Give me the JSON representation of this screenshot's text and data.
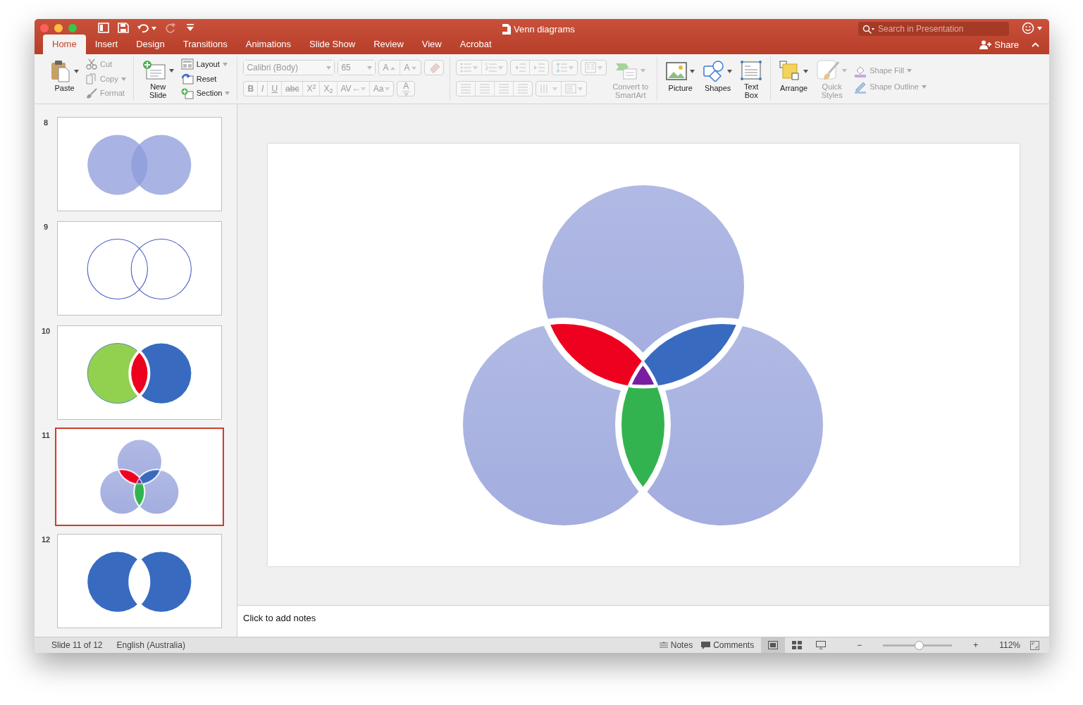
{
  "window": {
    "title": "Venn diagrams",
    "search": {
      "placeholder": "Search in Presentation"
    }
  },
  "quick_access": [
    {
      "disabled": false,
      "dropdown": false
    },
    {
      "disabled": false,
      "dropdown": false
    },
    {
      "disabled": false,
      "dropdown": true
    },
    {
      "disabled": true,
      "dropdown": false
    },
    {
      "disabled": false,
      "dropdown": false
    }
  ],
  "tabs": [
    {
      "label": "Home",
      "selected": true
    },
    {
      "label": "Insert",
      "selected": false
    },
    {
      "label": "Design",
      "selected": false
    },
    {
      "label": "Transitions",
      "selected": false
    },
    {
      "label": "Animations",
      "selected": false
    },
    {
      "label": "Slide Show",
      "selected": false
    },
    {
      "label": "Review",
      "selected": false
    },
    {
      "label": "View",
      "selected": false
    },
    {
      "label": "Acrobat",
      "selected": false
    }
  ],
  "share": "Share",
  "ribbon": [
    {
      "items": [
        {
          "kind": "large",
          "label": "Paste",
          "disabled": false,
          "dropdown": true
        },
        {
          "kind": "small",
          "label": "Cut",
          "disabled": true,
          "dropdown": false
        },
        {
          "kind": "small",
          "label": "Copy",
          "disabled": true,
          "dropdown": true
        },
        {
          "kind": "small",
          "label": "Format",
          "disabled": true,
          "dropdown": false
        }
      ]
    },
    {
      "items": [
        {
          "kind": "large",
          "label": "New\nSlide",
          "disabled": false,
          "dropdown": true
        },
        {
          "kind": "small",
          "label": "Layout",
          "disabled": false,
          "dropdown": true
        },
        {
          "kind": "small",
          "label": "Reset",
          "disabled": false,
          "dropdown": false
        },
        {
          "kind": "small",
          "label": "Section",
          "disabled": false,
          "dropdown": true
        }
      ]
    },
    {
      "rows": [
        {
          "segments": [
            {
              "tools": [
                {
                  "kind": "field",
                  "value": "Calibri (Body)",
                  "disabled": true
                }
              ]
            },
            {
              "tools": [
                {
                  "kind": "field",
                  "value": "65",
                  "disabled": true
                }
              ]
            },
            {
              "tools": [
                {
                  "kind": "tool",
                  "label": "A",
                  "disabled": true,
                  "dropdown": false
                },
                {
                  "kind": "tool",
                  "label": "A",
                  "disabled": true,
                  "dropdown": false
                }
              ]
            },
            {
              "tools": [
                {
                  "kind": "tool",
                  "disabled": true,
                  "dropdown": false
                }
              ]
            }
          ]
        },
        {
          "segments": [
            {
              "tools": [
                {
                  "kind": "tool",
                  "label": "B",
                  "disabled": true,
                  "dropdown": false
                },
                {
                  "kind": "tool",
                  "label": "I",
                  "disabled": true,
                  "dropdown": false
                },
                {
                  "kind": "tool",
                  "label": "U",
                  "disabled": true,
                  "dropdown": false
                },
                {
                  "kind": "tool",
                  "label": "abc",
                  "disabled": true,
                  "dropdown": false
                },
                {
                  "kind": "tool",
                  "label": "X$^{2}$",
                  "disabled": true,
                  "dropdown": false
                },
                {
                  "kind": "tool",
                  "label": "X$_{2}$",
                  "disabled": true,
                  "dropdown": false
                },
                {
                  "kind": "tool",
                  "label": "AV",
                  "disabled": true,
                  "dropdown": true
                },
                {
                  "kind": "tool",
                  "label": "Aa",
                  "disabled": true,
                  "dropdown": true
                }
              ]
            },
            {
              "tools": [
                {
                  "kind": "tool",
                  "label": "A",
                  "disabled": true,
                  "dropdown": true
                }
              ]
            }
          ]
        }
      ]
    },
    {
      "rows": [
        {
          "segments": [
            {
              "tools": [
                {
                  "kind": "tool",
                  "disabled": true,
                  "dropdown": true
                },
                {
                  "kind": "tool",
                  "disabled": true,
                  "dropdown": true
                }
              ]
            },
            {
              "tools": [
                {
                  "kind": "tool",
                  "disabled": true,
                  "dropdown": false
                },
                {
                  "kind": "tool",
                  "disabled": true,
                  "dropdown": false
                }
              ]
            },
            {
              "tools": [
                {
                  "kind": "tool",
                  "disabled": true,
                  "dropdown": true
                }
              ]
            },
            {
              "tools": [
                {
                  "kind": "tool",
                  "disabled": true,
                  "dropdown": true
                }
              ]
            }
          ]
        },
        {
          "segments": [
            {
              "tools": [
                {
                  "kind": "tool",
                  "disabled": true,
                  "dropdown": false
                },
                {
                  "kind": "tool",
                  "disabled": true,
                  "dropdown": false
                },
                {
                  "kind": "tool",
                  "disabled": true,
                  "dropdown": false
                },
                {
                  "kind": "tool",
                  "disabled": true,
                  "dropdown": false
                }
              ]
            },
            {
              "tools": [
                {
                  "kind": "tool",
                  "disabled": true,
                  "dropdown": true
                },
                {
                  "kind": "tool",
                  "disabled": true,
                  "dropdown": true
                }
              ]
            }
          ]
        }
      ],
      "items": [
        {
          "kind": "large",
          "label": "Convert to\nSmartArt",
          "disabled": true,
          "dropdown": true
        }
      ]
    },
    {
      "items": [
        {
          "kind": "large",
          "label": "Picture",
          "disabled": false,
          "dropdown": true
        },
        {
          "kind": "large",
          "label": "Shapes",
          "disabled": false,
          "dropdown": true
        },
        {
          "kind": "large",
          "label": "Text\nBox",
          "disabled": false,
          "dropdown": false
        }
      ]
    },
    {
      "items": [
        {
          "kind": "large",
          "label": "Arrange",
          "disabled": false,
          "dropdown": true
        },
        {
          "kind": "large",
          "label": "Quick\nStyles",
          "disabled": true,
          "dropdown": true
        },
        {
          "kind": "small",
          "label": "Shape Fill",
          "disabled": true,
          "dropdown": true
        },
        {
          "kind": "small",
          "label": "Shape Outline",
          "disabled": true,
          "dropdown": true
        }
      ]
    }
  ],
  "thumbnails": [
    {
      "number": "8",
      "kind": "transparent",
      "selected": false
    },
    {
      "number": "9",
      "kind": "outline",
      "selected": false
    },
    {
      "number": "10",
      "kind": "colored",
      "selected": false
    },
    {
      "number": "11",
      "kind": "three",
      "selected": true
    },
    {
      "number": "12",
      "kind": "cutout",
      "selected": false
    }
  ],
  "slide": {
    "kind": "three"
  },
  "notes": {
    "placeholder": "Click to add notes"
  },
  "status_bar": {
    "slide_position": "Slide 11 of 12",
    "language": "English (Australia)",
    "notes": "Notes",
    "comments": "Comments",
    "views": [
      {
        "selected": true
      },
      {
        "selected": false
      },
      {
        "selected": false
      }
    ],
    "zoom_out": "−",
    "zoom_in": "+",
    "zoom": {
      "level": 0.52,
      "reading": "112%"
    }
  }
}
